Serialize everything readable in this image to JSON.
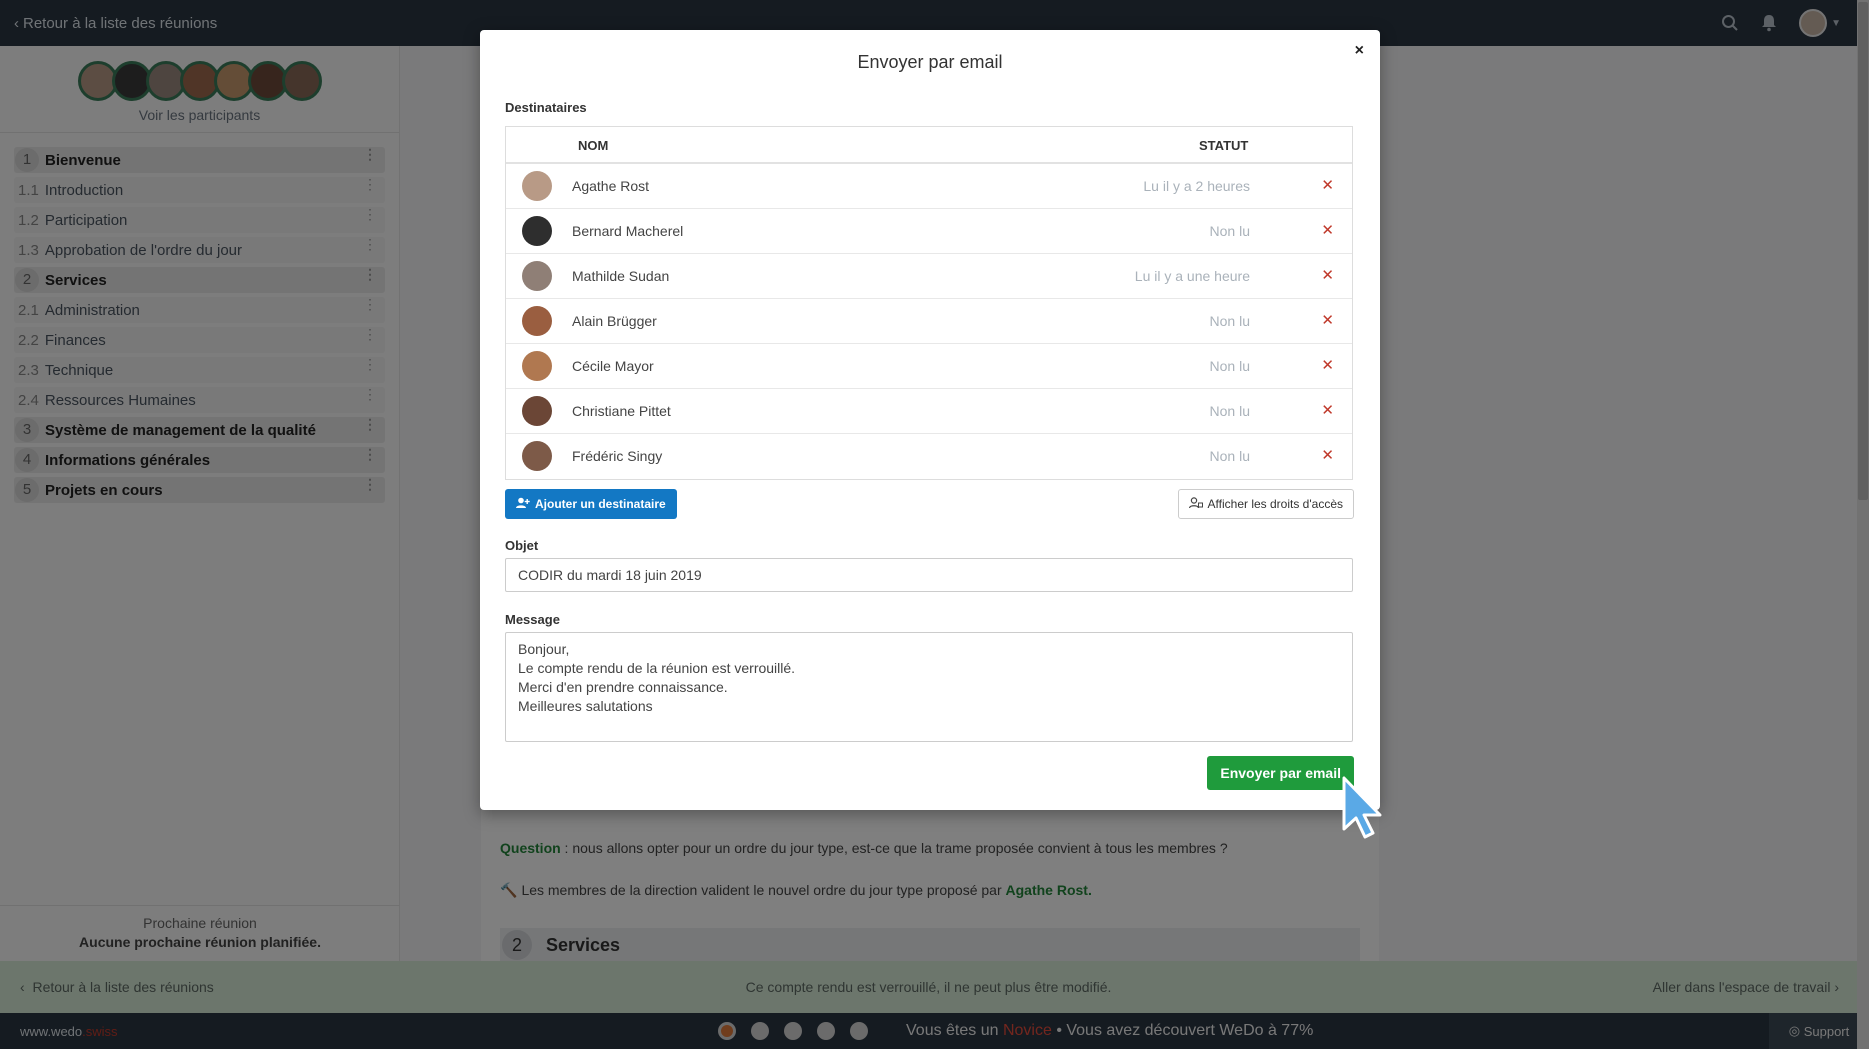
{
  "topbar": {
    "back_label": "Retour à la liste des réunions",
    "icons": [
      "search-icon",
      "bell-icon",
      "user-avatar",
      "chevron-down-icon"
    ]
  },
  "sidebar": {
    "see_participants": "Voir les participants",
    "agenda": [
      {
        "num": "1",
        "label": "Bienvenue",
        "type": "main"
      },
      {
        "num": "1.1",
        "label": "Introduction",
        "type": "sub"
      },
      {
        "num": "1.2",
        "label": "Participation",
        "type": "sub"
      },
      {
        "num": "1.3",
        "label": "Approbation de l'ordre du jour",
        "type": "sub"
      },
      {
        "num": "2",
        "label": "Services",
        "type": "main"
      },
      {
        "num": "2.1",
        "label": "Administration",
        "type": "sub"
      },
      {
        "num": "2.2",
        "label": "Finances",
        "type": "sub"
      },
      {
        "num": "2.3",
        "label": "Technique",
        "type": "sub"
      },
      {
        "num": "2.4",
        "label": "Ressources Humaines",
        "type": "sub"
      },
      {
        "num": "3",
        "label": "Système de management de la qualité",
        "type": "main"
      },
      {
        "num": "4",
        "label": "Informations générales",
        "type": "main"
      },
      {
        "num": "5",
        "label": "Projets en cours",
        "type": "main"
      }
    ],
    "next_meeting_title": "Prochaine réunion",
    "next_meeting_value": "Aucune prochaine réunion planifiée."
  },
  "content": {
    "question_label": "Question",
    "question_text": " : nous allons opter pour un ordre du jour type, est-ce que la trame proposée convient à tous les membres ?",
    "decision_text": "Les membres de la direction valident le nouvel ordre du jour type proposé par ",
    "decision_who": "Agathe Rost.",
    "section_num": "2",
    "section_title": "Services"
  },
  "lockbar": {
    "back_label": "Retour à la liste des réunions",
    "message": "Ce compte rendu est verrouillé, il ne peut plus être modifié.",
    "workspace_label": "Aller dans l'espace de travail"
  },
  "bottombar": {
    "brand_main": "www.wedo",
    "brand_suffix": ".swiss",
    "level_prefix": "Vous êtes un ",
    "level_name": "Novice",
    "level_suffix": " • Vous avez découvert WeDo à 77%",
    "support_label": "Support"
  },
  "modal": {
    "title": "Envoyer par email",
    "close": "×",
    "recipients_label": "Destinataires",
    "col_name": "NOM",
    "col_status": "STATUT",
    "recipients": [
      {
        "name": "Agathe Rost",
        "status": "Lu il y a 2 heures"
      },
      {
        "name": "Bernard Macherel",
        "status": "Non lu"
      },
      {
        "name": "Mathilde Sudan",
        "status": "Lu il y a une heure"
      },
      {
        "name": "Alain Brügger",
        "status": "Non lu"
      },
      {
        "name": "Cécile Mayor",
        "status": "Non lu"
      },
      {
        "name": "Christiane Pittet",
        "status": "Non lu"
      },
      {
        "name": "Frédéric Singy",
        "status": "Non lu"
      }
    ],
    "add_recipient": "Ajouter un destinataire",
    "show_rights": "Afficher les droits d'accès",
    "subject_label": "Objet",
    "subject_value": "CODIR du mardi 18 juin 2019",
    "message_label": "Message",
    "message_value": "Bonjour,\nLe compte rendu de la réunion est verrouillé.\nMerci d'en prendre connaissance.\nMeilleures salutations",
    "send_label": "Envoyer par email"
  },
  "colors": {
    "topbar": "#2b3643",
    "primary_blue": "#1378c4",
    "send_green": "#1f9b3c",
    "remove_red": "#c0392b",
    "lockbar_green": "#d8ecd9"
  }
}
